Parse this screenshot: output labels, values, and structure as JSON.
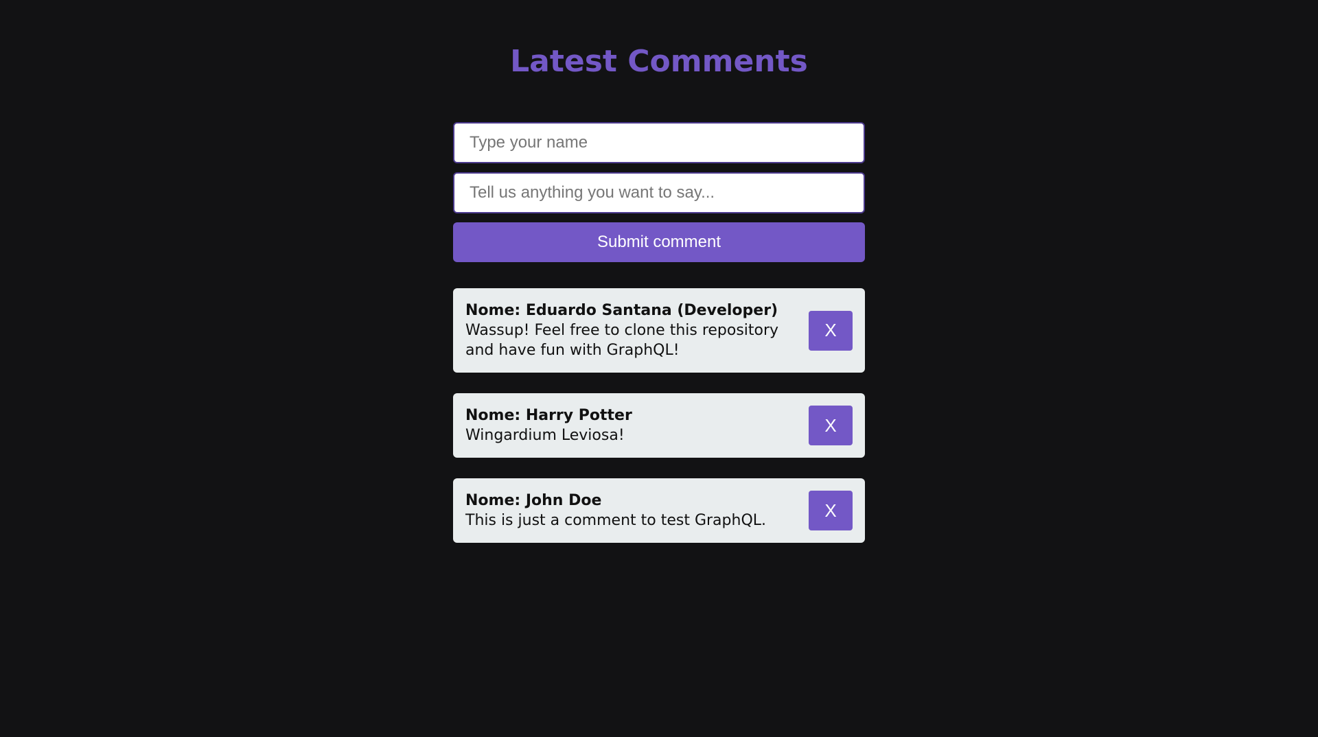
{
  "header": {
    "title": "Latest Comments"
  },
  "form": {
    "name_placeholder": "Type your name",
    "message_placeholder": "Tell us anything you want to say...",
    "submit_label": "Submit comment"
  },
  "comments": [
    {
      "name": "Nome: Eduardo Santana (Developer)",
      "text": "Wassup! Feel free to clone this repository and have fun with GraphQL!",
      "delete_label": "X"
    },
    {
      "name": "Nome: Harry Potter",
      "text": "Wingardium Leviosa!",
      "delete_label": "X"
    },
    {
      "name": "Nome: John Doe",
      "text": "This is just a comment to test GraphQL.",
      "delete_label": "X"
    }
  ],
  "colors": {
    "background": "#121214",
    "accent": "#7358c6",
    "card": "#e9edee"
  }
}
